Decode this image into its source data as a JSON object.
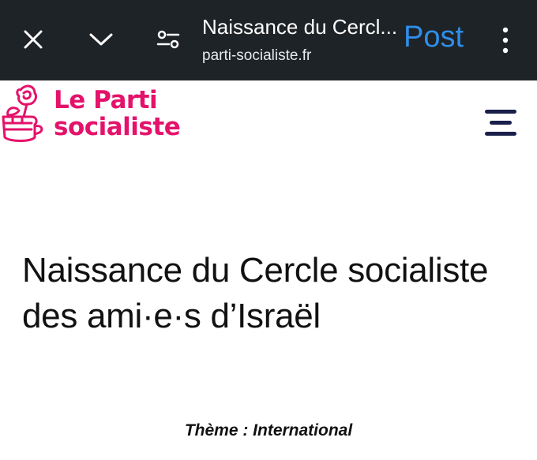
{
  "browser": {
    "page_title": "Naissance du Cercl...",
    "domain": "parti-socialiste.fr",
    "post_label": "Post",
    "icons": [
      "close-icon",
      "chevron-down-icon",
      "tune-icon",
      "more-vertical-icon"
    ]
  },
  "site": {
    "logo_line1": "Le Parti",
    "logo_line2": "socialiste",
    "brand_color": "#e4126b",
    "menu_icon": "hamburger-menu-icon"
  },
  "article": {
    "title": "Naissance du Cercle socialiste des ami·e·s d’Israël",
    "theme": "Thème : International"
  }
}
